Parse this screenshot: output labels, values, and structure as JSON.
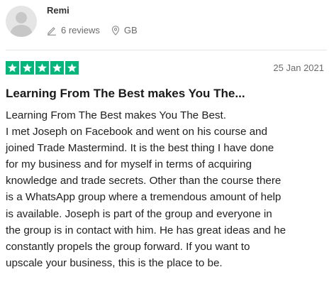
{
  "reviewer": {
    "name": "Remi",
    "reviews_count": "6 reviews",
    "country": "GB"
  },
  "review": {
    "rating": 5,
    "rating_max": 5,
    "star_color": "#00b67a",
    "date": "25 Jan 2021",
    "title": "Learning From The Best makes You The...",
    "body_lines": [
      "Learning From The Best makes You The Best.",
      "I met Joseph on Facebook and went on his course and",
      "joined Trade Mastermind. It is the best thing I have done",
      "for my business and for myself in terms of acquiring",
      "knowledge and trade secrets. Other than the course there",
      "is a WhatsApp group where a tremendous amount of help",
      "is available. Joseph is part of the group and everyone in",
      "the group is in contact with him. He has great ideas and he",
      "constantly propels the group forward. If you want to",
      "upscale your business, this is the place to be."
    ]
  },
  "icons": {
    "avatar": "user-silhouette-icon",
    "reviews": "pencil-icon",
    "location": "map-pin-icon",
    "star": "star-icon"
  }
}
